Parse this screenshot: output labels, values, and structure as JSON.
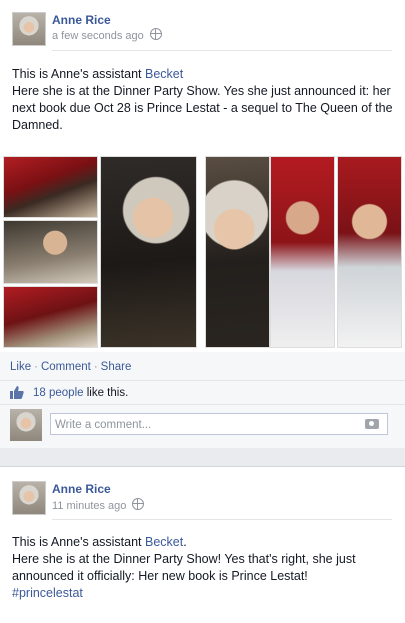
{
  "posts": [
    {
      "author": "Anne Rice",
      "time": "a few seconds ago",
      "text_line1_pre": "This is Anne's assistant ",
      "text_line1_link": "Becket",
      "text_rest": "Here she is at the Dinner Party Show. Yes she just announced it: her next book due Oct 28 is Prince Lestat - a sequel to The Queen of the Damned.",
      "actions": {
        "like": "Like",
        "comment": "Comment",
        "share": "Share",
        "separator": "·"
      },
      "likes": {
        "count_link": "18 people",
        "suffix": " like this."
      },
      "comment_placeholder": "Write a comment..."
    },
    {
      "author": "Anne Rice",
      "time": "11 minutes ago",
      "text_line1_pre": "This is Anne's assistant ",
      "text_line1_link": "Becket",
      "text_line1_post": ".",
      "text_rest": "Here she is at the Dinner Party Show! Yes that's right, she just announced it officially: Her new book is Prince Lestat!",
      "hashtag": "#princelestat"
    }
  ],
  "icons": [
    "globe-icon",
    "thumbs-up-icon",
    "camera-icon"
  ],
  "colors": {
    "link": "#3b5998",
    "muted": "#90949c",
    "background": "#e9ebee"
  }
}
